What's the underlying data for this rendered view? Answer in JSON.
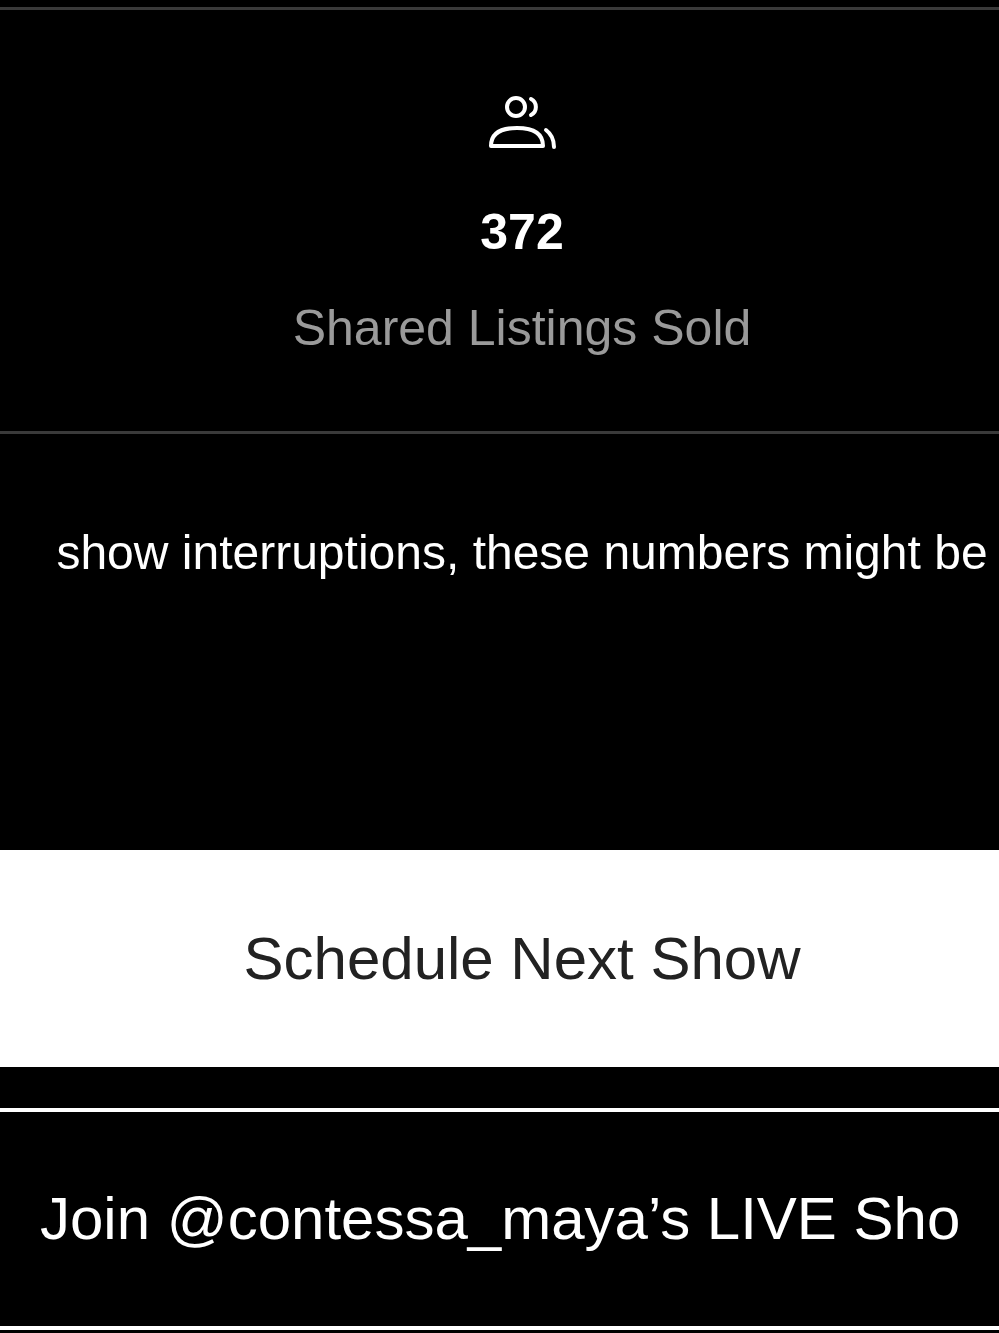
{
  "stat": {
    "value": "372",
    "label": "Shared Listings Sold"
  },
  "note": "show interruptions, these numbers might be",
  "buttons": [
    {
      "kind": "filled",
      "label": "Schedule Next Show"
    },
    {
      "kind": "outlined",
      "label": "Join @contessa_maya’s LIVE Sho"
    }
  ]
}
